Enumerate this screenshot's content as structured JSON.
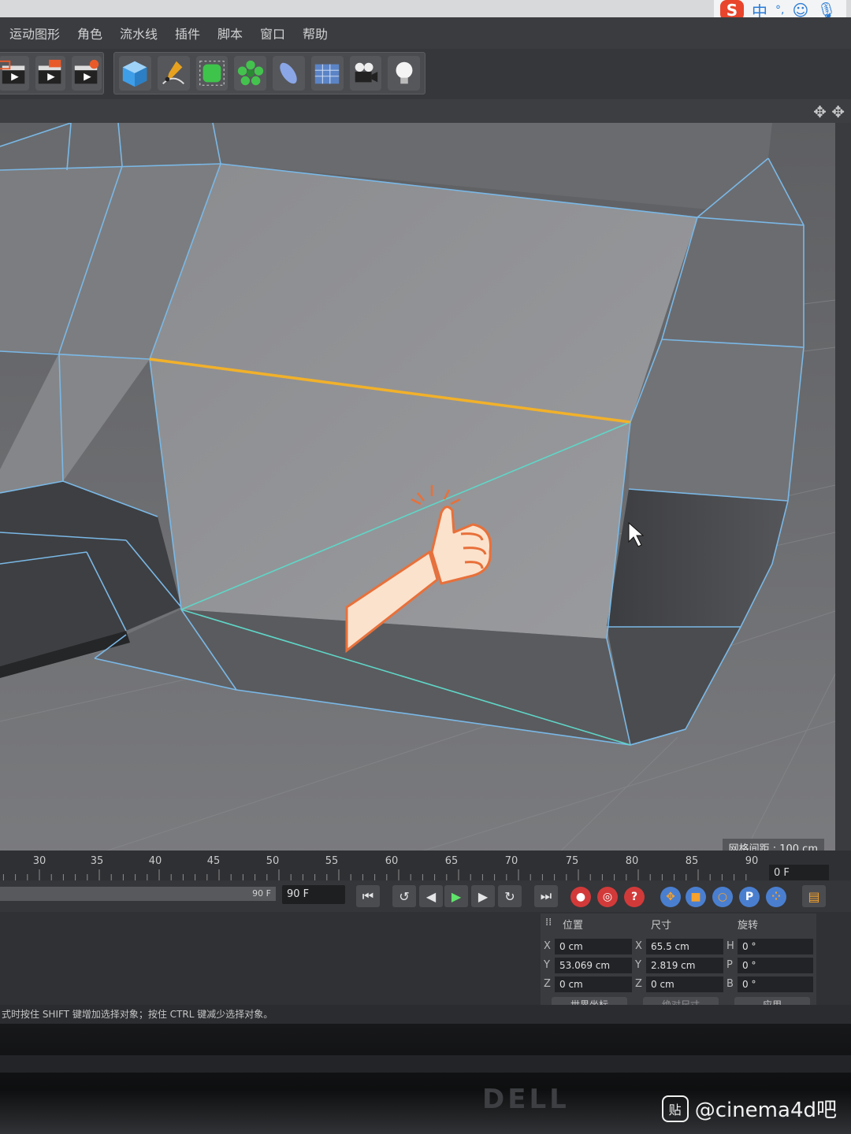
{
  "menu": {
    "items": [
      "运动图形",
      "角色",
      "流水线",
      "插件",
      "脚本",
      "窗口",
      "帮助"
    ]
  },
  "ime": {
    "logo": "S",
    "lang": "中",
    "punct": "°,",
    "emoji_icon": "smiley-icon",
    "mic_icon": "microphone-icon"
  },
  "toolbar": {
    "left_icons": [
      "render-region-icon",
      "render-view-icon",
      "render-settings-icon"
    ],
    "right_icons": [
      "cube-icon",
      "pen-icon",
      "subdivision-icon",
      "cloner-icon",
      "deformer-icon",
      "floor-icon",
      "camera-icon",
      "light-icon"
    ]
  },
  "viewport": {
    "grid_spacing": "网格间距 : 100 cm",
    "colors": {
      "selected_edge": "#f2b12a",
      "wire": "#7ab8e6",
      "diagonal": "#5fd6c8"
    }
  },
  "timeline": {
    "ticks": [
      "30",
      "35",
      "40",
      "45",
      "50",
      "55",
      "60",
      "65",
      "70",
      "75",
      "80",
      "85",
      "90"
    ],
    "current_frame": "0 F"
  },
  "transport": {
    "range_end": "90 F",
    "end_field": "90 F"
  },
  "coords": {
    "headers": {
      "position": "位置",
      "size": "尺寸",
      "rotation": "旋转"
    },
    "position": {
      "x": "0 cm",
      "y": "53.069 cm",
      "z": "0 cm"
    },
    "size": {
      "x": "65.5 cm",
      "y": "2.819 cm",
      "z": "0 cm"
    },
    "rotation": {
      "h": "0 °",
      "p": "0 °",
      "b": "0 °"
    },
    "axis_labels": {
      "x": "X",
      "y": "Y",
      "z": "Z",
      "h": "H",
      "p": "P",
      "b": "B"
    },
    "mode_dropdown": "世界坐标",
    "size_dropdown": "绝对尺寸",
    "apply_button": "应用"
  },
  "status_bar": "式时按住 SHIFT 键增加选择对象；按住 CTRL 键减少选择对象。",
  "monitor": {
    "brand": "DELL"
  },
  "watermark": {
    "logo": "贴",
    "text": "@cinema4d吧"
  }
}
